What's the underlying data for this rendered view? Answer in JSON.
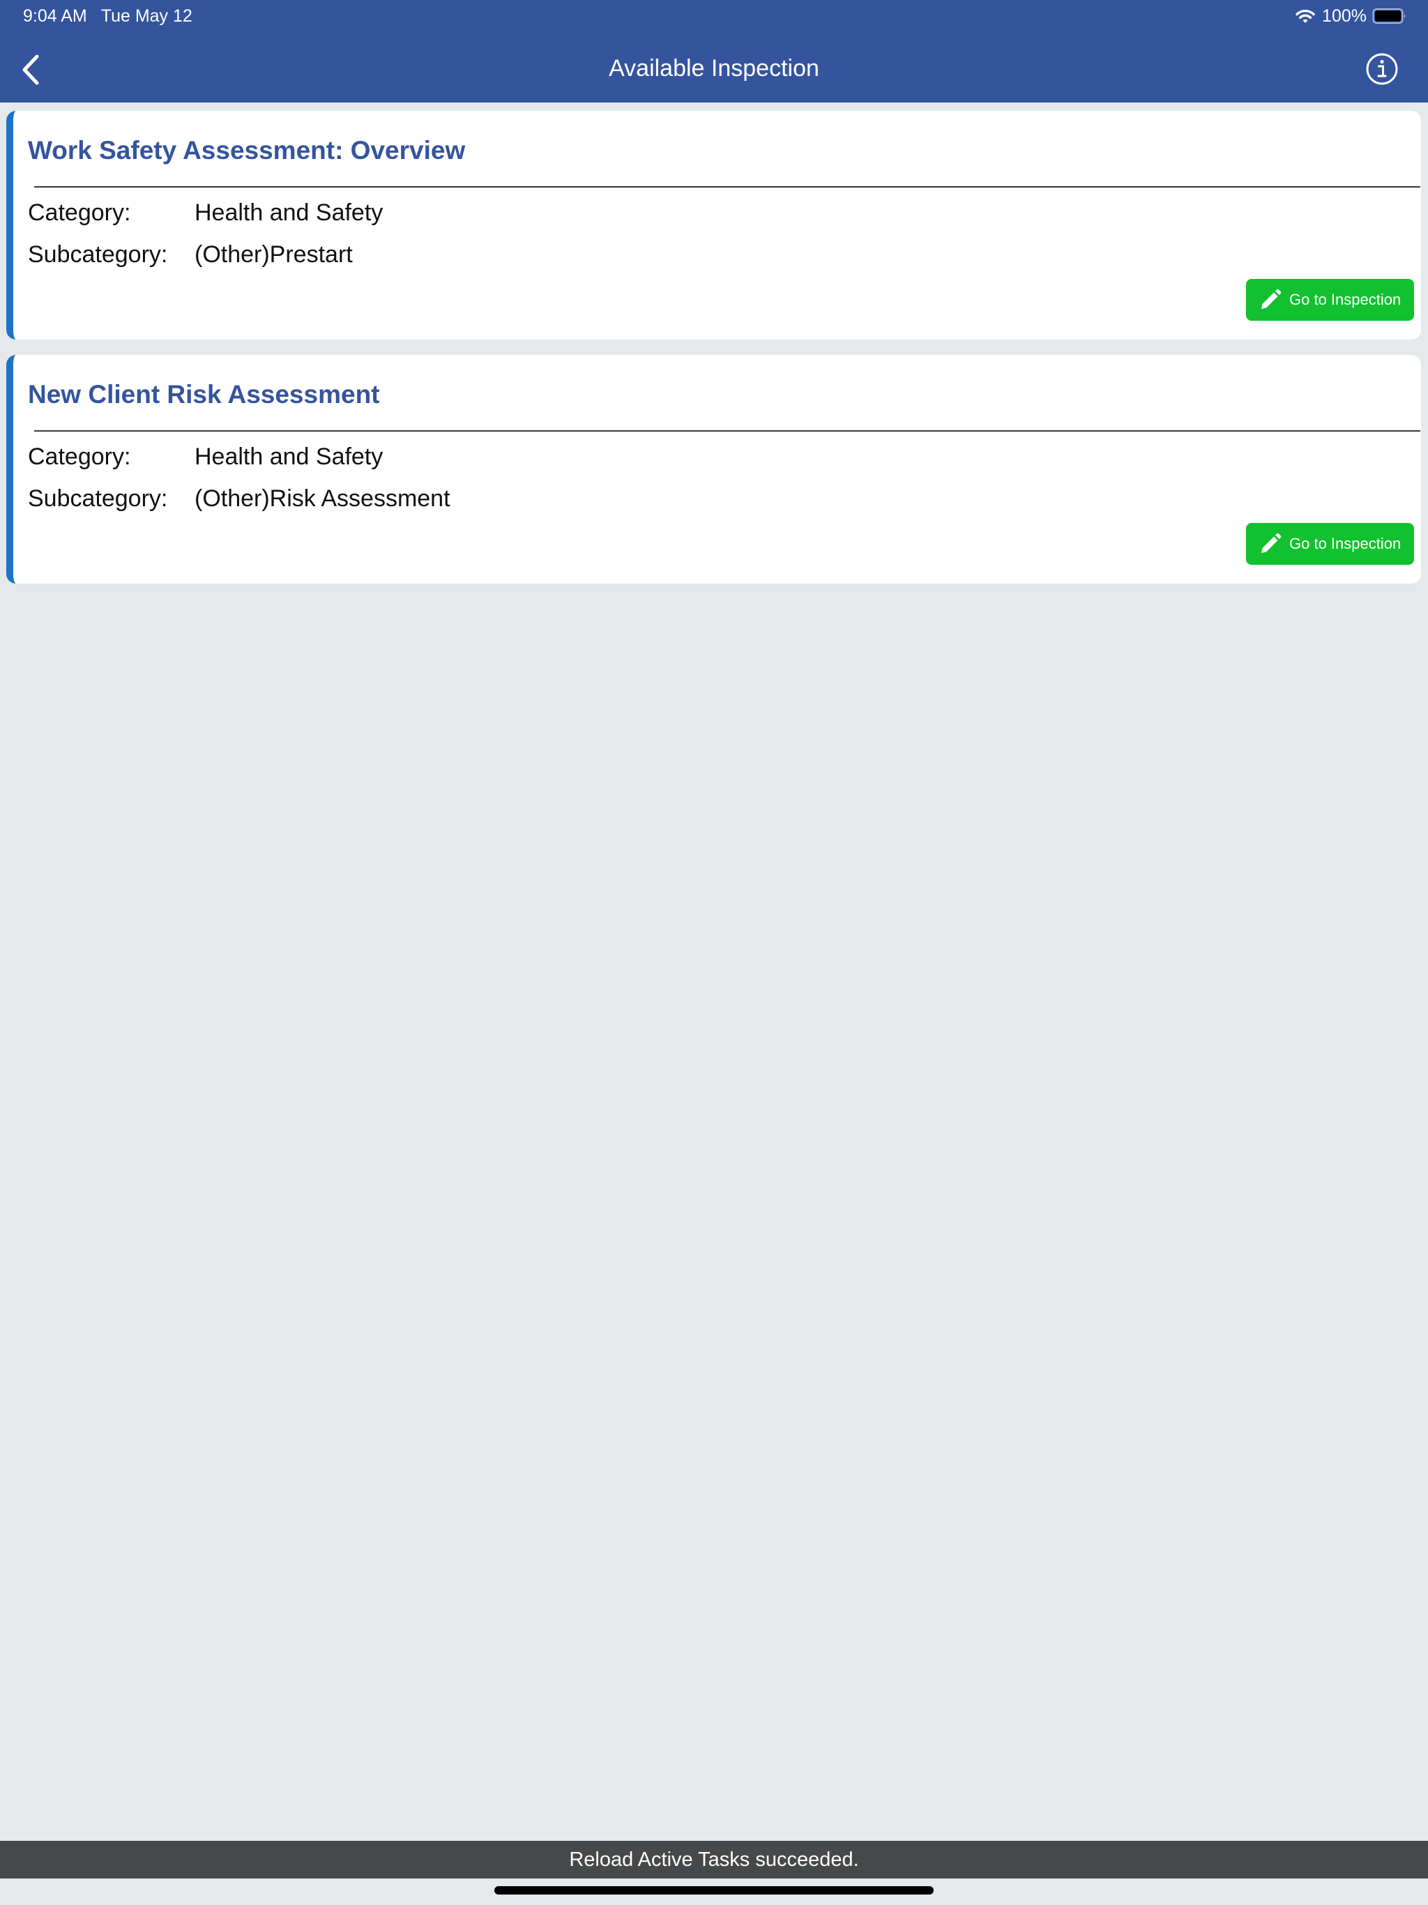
{
  "status_bar": {
    "time": "9:04 AM",
    "date": "Tue May 12",
    "battery": "100%"
  },
  "nav": {
    "title": "Available Inspection",
    "back_icon": "chevron-left-icon",
    "info_icon": "info-circle-icon"
  },
  "inspections": [
    {
      "title": "Work Safety Assessment: Overview",
      "category_label": "Category:",
      "category": "Health and Safety",
      "subcategory_label": "Subcategory:",
      "subcategory": "(Other)Prestart",
      "button_label": "Go to Inspection"
    },
    {
      "title": "New Client Risk Assessment",
      "category_label": "Category:",
      "category": "Health and Safety",
      "subcategory_label": "Subcategory:",
      "subcategory": "(Other)Risk Assessment",
      "button_label": "Go to Inspection"
    }
  ],
  "toast": {
    "message": "Reload Active Tasks succeeded."
  },
  "colors": {
    "header": "#34549d",
    "title_text": "#34549d",
    "card_accent": "#1d74c6",
    "button": "#12c12f",
    "background": "#e6e9ec",
    "toast": "#464849"
  }
}
